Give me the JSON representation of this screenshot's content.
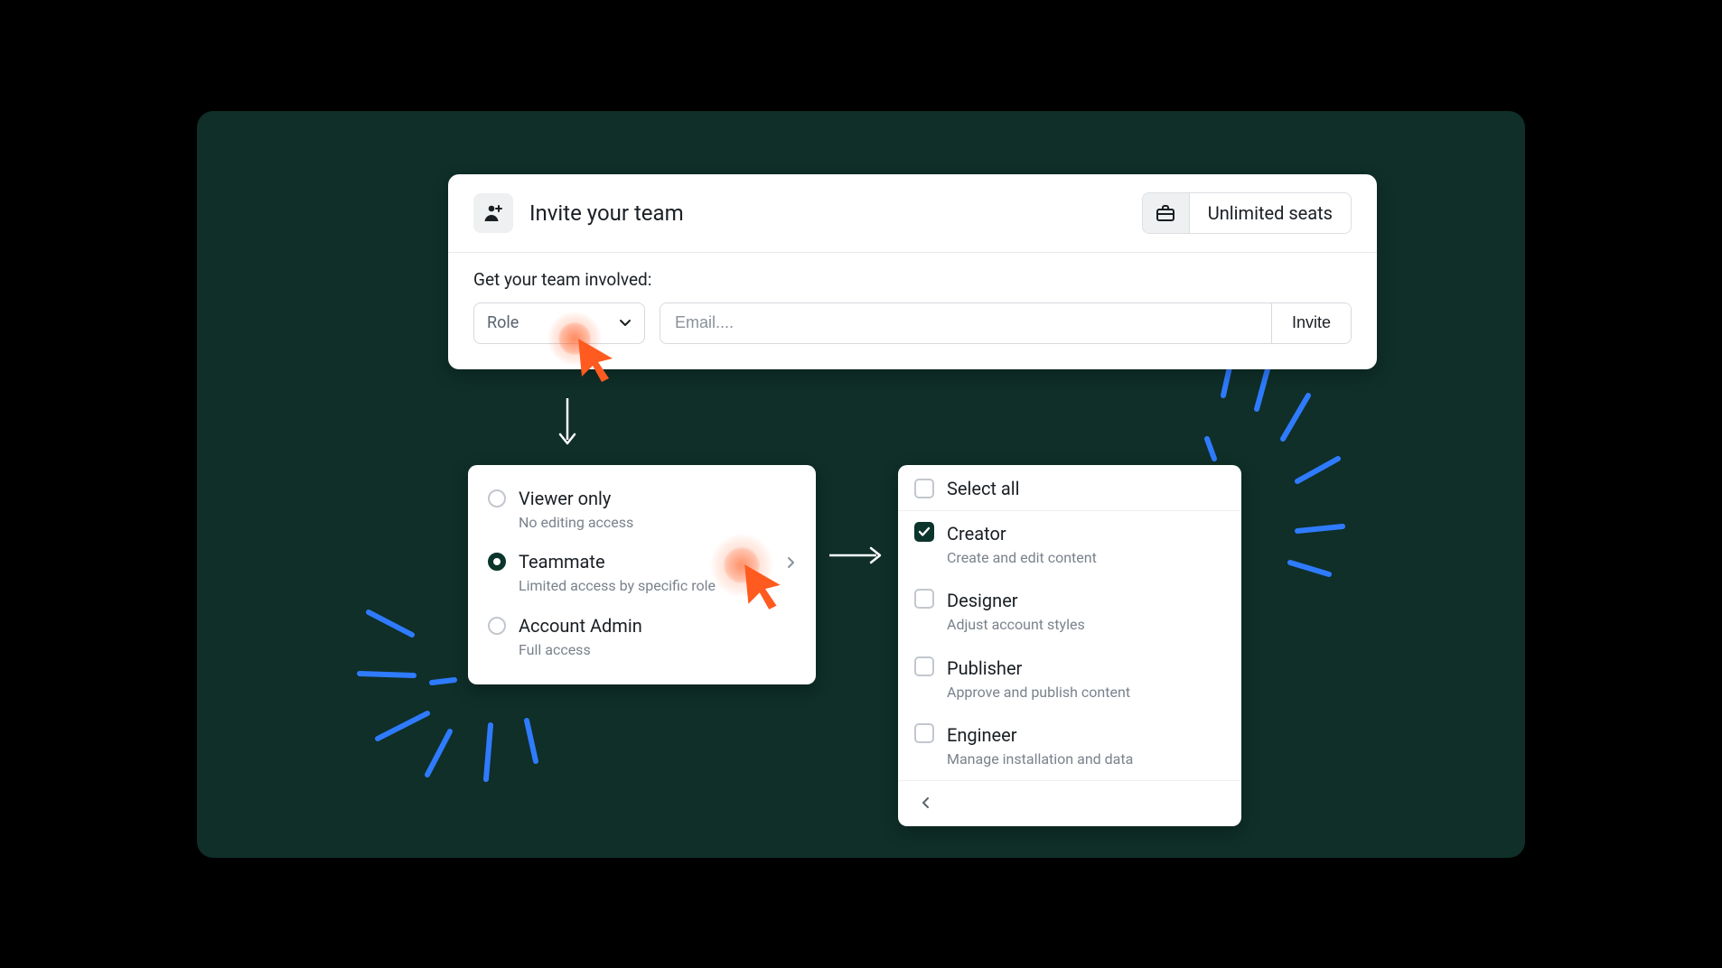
{
  "header": {
    "title": "Invite your team",
    "seats_label": "Unlimited seats"
  },
  "form": {
    "involved_label": "Get your team involved:",
    "role_placeholder": "Role",
    "email_placeholder": "Email....",
    "invite_button": "Invite"
  },
  "roles": [
    {
      "name": "Viewer only",
      "desc": "No editing access",
      "selected": false,
      "has_sub": false
    },
    {
      "name": "Teammate",
      "desc": "Limited access by specific role",
      "selected": true,
      "has_sub": true
    },
    {
      "name": "Account Admin",
      "desc": "Full access",
      "selected": false,
      "has_sub": false
    }
  ],
  "perm_select_all": "Select all",
  "permissions": [
    {
      "name": "Creator",
      "desc": "Create and edit content",
      "checked": true
    },
    {
      "name": "Designer",
      "desc": "Adjust account styles",
      "checked": false
    },
    {
      "name": "Publisher",
      "desc": "Approve and publish content",
      "checked": false
    },
    {
      "name": "Engineer",
      "desc": "Manage installation and data",
      "checked": false
    }
  ]
}
